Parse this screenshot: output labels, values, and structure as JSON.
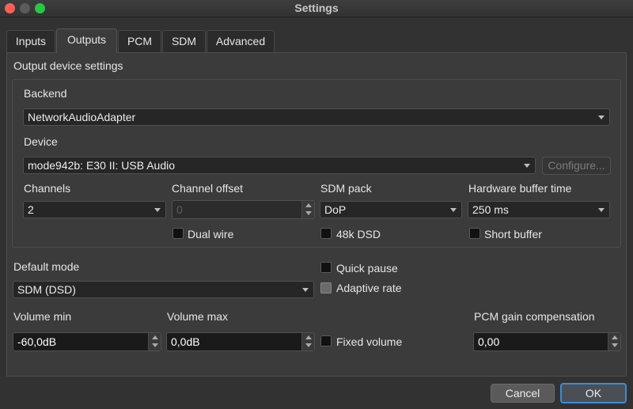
{
  "window": {
    "title": "Settings"
  },
  "tabs": [
    {
      "label": "Inputs",
      "active": false
    },
    {
      "label": "Outputs",
      "active": true
    },
    {
      "label": "PCM",
      "active": false
    },
    {
      "label": "SDM",
      "active": false
    },
    {
      "label": "Advanced",
      "active": false
    }
  ],
  "output_device": {
    "group_title": "Output device settings",
    "backend_label": "Backend",
    "backend_value": "NetworkAudioAdapter",
    "device_label": "Device",
    "device_value": "mode942b: E30 II: USB Audio",
    "configure_label": "Configure...",
    "channels_label": "Channels",
    "channels_value": "2",
    "channel_offset_label": "Channel offset",
    "channel_offset_value": "0",
    "sdm_pack_label": "SDM pack",
    "sdm_pack_value": "DoP",
    "hw_buffer_label": "Hardware buffer time",
    "hw_buffer_value": "250 ms",
    "dual_wire_label": "Dual wire",
    "dsd48k_label": "48k DSD",
    "short_buffer_label": "Short buffer"
  },
  "general": {
    "default_mode_label": "Default mode",
    "default_mode_value": "SDM (DSD)",
    "quick_pause_label": "Quick pause",
    "adaptive_rate_label": "Adaptive rate",
    "volume_min_label": "Volume min",
    "volume_min_value": "-60,0dB",
    "volume_max_label": "Volume max",
    "volume_max_value": "0,0dB",
    "fixed_volume_label": "Fixed volume",
    "pcm_gain_label": "PCM gain compensation",
    "pcm_gain_value": "0,00"
  },
  "buttons": {
    "cancel": "Cancel",
    "ok": "OK"
  }
}
